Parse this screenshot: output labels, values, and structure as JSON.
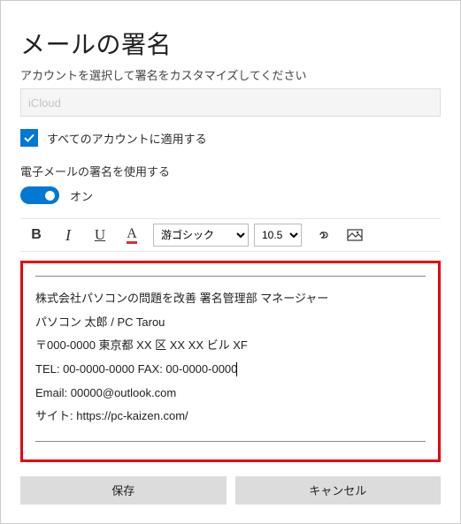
{
  "title": "メールの署名",
  "subtitle": "アカウントを選択して署名をカスタマイズしてください",
  "account_select": {
    "value": "iCloud"
  },
  "apply_all": {
    "label": "すべてのアカウントに適用する",
    "checked": true
  },
  "use_signature": {
    "label": "電子メールの署名を使用する",
    "toggle_text": "オン",
    "enabled": true
  },
  "toolbar": {
    "bold": "B",
    "italic": "I",
    "underline": "U",
    "fontcolor_letter": "A",
    "font_family": "游ゴシック",
    "font_size": "10.5"
  },
  "signature": {
    "lines": [
      "株式会社パソコンの問題を改善 署名管理部 マネージャー",
      "パソコン 太郎 / PC Tarou",
      "〒000-0000 東京都 XX 区 XX XX ビル XF",
      "TEL: 00-0000-0000 FAX: 00-0000-0000",
      "Email: 00000@outlook.com",
      "サイト: https://pc-kaizen.com/"
    ]
  },
  "buttons": {
    "save": "保存",
    "cancel": "キャンセル"
  }
}
